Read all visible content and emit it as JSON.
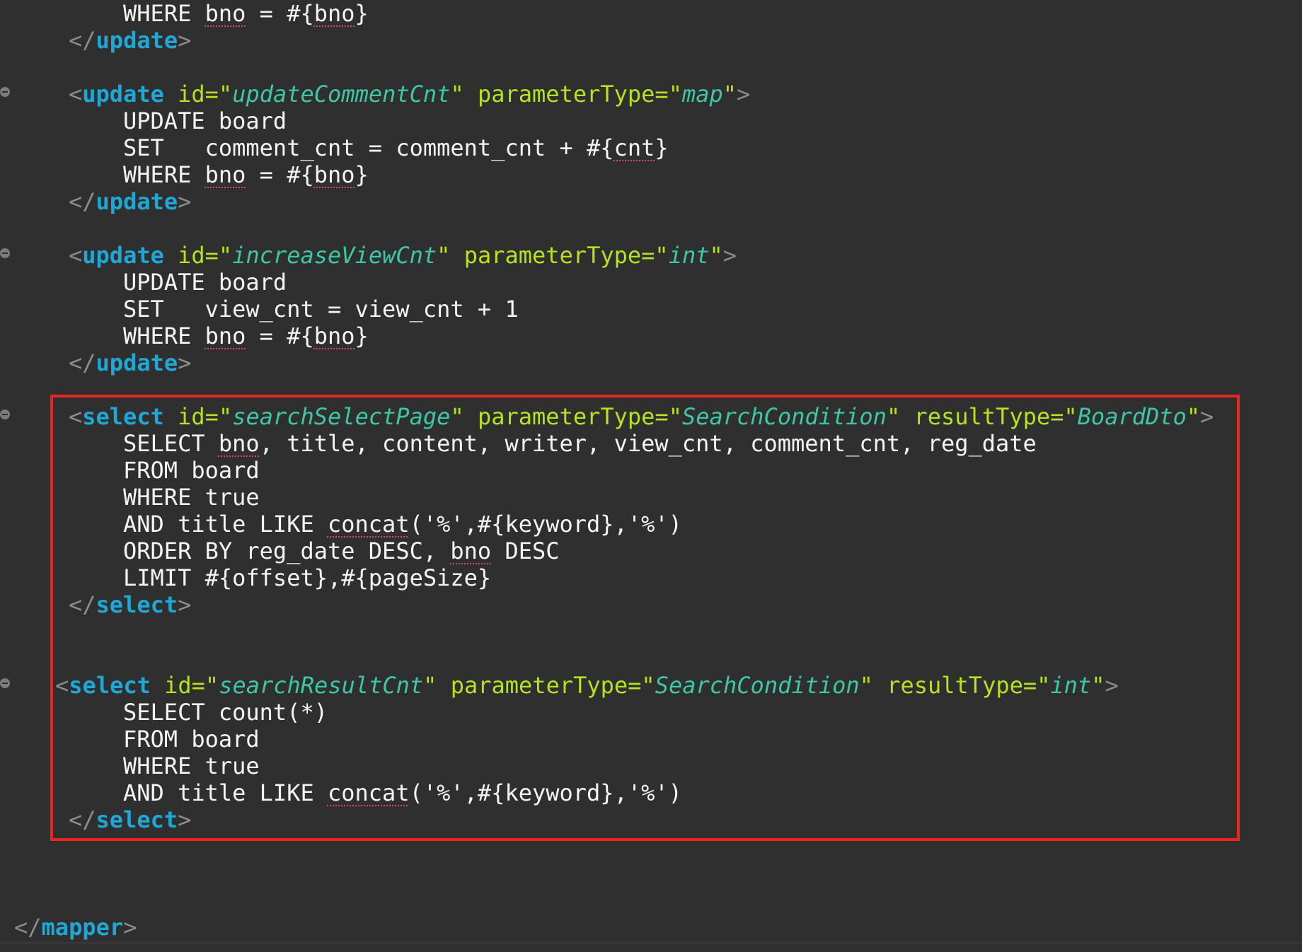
{
  "editor": {
    "highlight_color": "#e8261b",
    "lines": {
      "l1": {
        "kw": "WHERE",
        "a": "bno",
        "b": " = #{",
        "c": "bno",
        "d": "}"
      },
      "l2": {
        "open": "</",
        "tag": "update",
        "close": ">"
      },
      "l4": {
        "open": "<",
        "tag": "update",
        "attr1": "id",
        "val1": "updateCommentCnt",
        "attr2": "parameterType",
        "val2": "map",
        "close": ">"
      },
      "l5": {
        "text": "UPDATE board"
      },
      "l6": {
        "a": "SET   comment_cnt = comment_cnt + #{",
        "b": "cnt",
        "c": "}"
      },
      "l7": {
        "kw": "WHERE",
        "a": "bno",
        "b": " = #{",
        "c": "bno",
        "d": "}"
      },
      "l8": {
        "open": "</",
        "tag": "update",
        "close": ">"
      },
      "l10": {
        "open": "<",
        "tag": "update",
        "attr1": "id",
        "val1": "increaseViewCnt",
        "attr2": "parameterType",
        "val2": "int",
        "close": ">"
      },
      "l11": {
        "text": "UPDATE board"
      },
      "l12": {
        "text": "SET   view_cnt = view_cnt + 1"
      },
      "l13": {
        "kw": "WHERE",
        "a": "bno",
        "b": " = #{",
        "c": "bno",
        "d": "}"
      },
      "l14": {
        "open": "</",
        "tag": "update",
        "close": ">"
      },
      "l16": {
        "open": "<",
        "tag": "select",
        "attr1": "id",
        "val1": "searchSelectPage",
        "attr2": "parameterType",
        "val2": "SearchCondition",
        "attr3": "resultType",
        "val3": "BoardDto",
        "close": ">"
      },
      "l17": {
        "a": "SELECT ",
        "b": "bno",
        "c": ", title, content, writer, view_cnt, comment_cnt, reg_date"
      },
      "l18": {
        "text": "FROM board"
      },
      "l19": {
        "text": "WHERE true"
      },
      "l20": {
        "a": "AND title LIKE ",
        "b": "concat",
        "c": "('%',#{keyword},'%')"
      },
      "l21": {
        "a": "ORDER BY reg_date DESC, ",
        "b": "bno",
        "c": " DESC"
      },
      "l22": {
        "text": "LIMIT #{offset},#{pageSize}"
      },
      "l23": {
        "open": "</",
        "tag": "select",
        "close": ">"
      },
      "l26": {
        "open": "<",
        "tag": "select",
        "attr1": "id",
        "val1": "searchResultCnt",
        "attr2": "parameterType",
        "val2": "SearchCondition",
        "attr3": "resultType",
        "val3": "int",
        "close": ">"
      },
      "l27": {
        "text": "SELECT count(*)"
      },
      "l28": {
        "text": "FROM board"
      },
      "l29": {
        "text": "WHERE true"
      },
      "l30": {
        "a": "AND title LIKE ",
        "b": "concat",
        "c": "('%',#{keyword},'%')"
      },
      "l31": {
        "open": "</",
        "tag": "select",
        "close": ">"
      },
      "l35": {
        "open": "</",
        "tag": "mapper",
        "close": ">"
      }
    }
  }
}
